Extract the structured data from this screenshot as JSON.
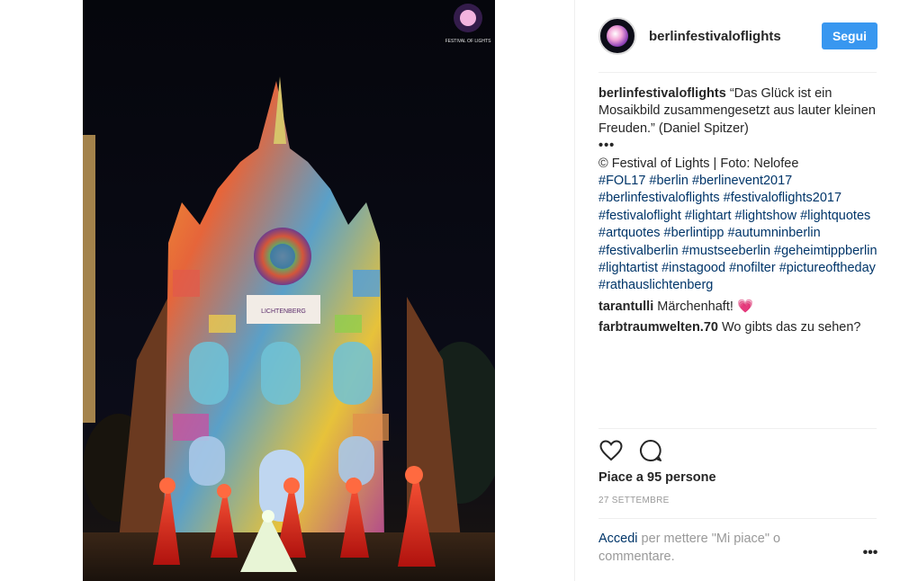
{
  "photo": {
    "watermark_text": "FESTIVAL OF LIGHTS",
    "banner_text": "LICHTENBERG"
  },
  "post": {
    "username": "berlinfestivaloflights",
    "follow_label": "Segui",
    "caption": {
      "author": "berlinfestivaloflights",
      "quote": "“Das Glück ist ein Mosaikbild zusammengesetzt aus lauter kleinen Freuden.” (Daniel Spitzer)",
      "dots": "•••",
      "credit": "© Festival of Lights | Foto: Nelofee",
      "hashtags": "#FOL17 #berlin #berlinevent2017 #berlinfestivaloflights #festivaloflights2017 #festivaloflight #lightart #lightshow #lightquotes #artquotes #berlintipp #autumninberlin #festivalberlin #mustseeberlin #geheimtippberlin #lightartist #instagood #nofilter #pictureoftheday #rathauslichtenberg"
    },
    "comments": [
      {
        "author": "tarantulli",
        "text": "Märchenhaft!",
        "emoji": "💗"
      },
      {
        "author": "farbtraumwelten.70",
        "text": "Wo gibts das zu sehen?"
      }
    ],
    "likes_text": "Piace a 95 persone",
    "date": "27 SETTEMBRE",
    "login_link": "Accedi",
    "login_rest": " per mettere \"Mi piace\" o commentare.",
    "more_label": "•••"
  },
  "icons": {
    "like": "heart-outline-icon",
    "comment": "speech-bubble-icon",
    "more": "ellipsis-icon"
  },
  "colors": {
    "link": "#003569",
    "follow": "#3897f0",
    "muted": "#999999"
  }
}
